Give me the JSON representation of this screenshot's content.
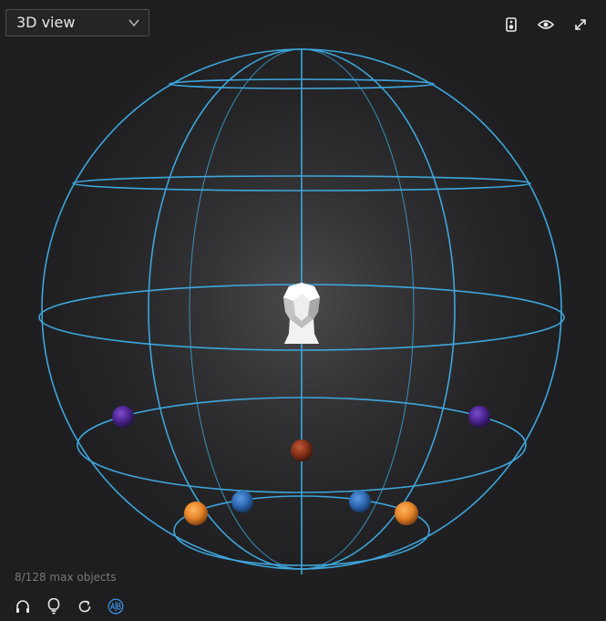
{
  "view_selector": {
    "selected": "3D view"
  },
  "toolbar_top": {
    "icons": [
      "speaker-icon",
      "eye-icon",
      "expand-icon"
    ]
  },
  "status": {
    "object_count": "8/128 max objects"
  },
  "toolbar_bottom": {
    "icons": [
      "headphones-icon",
      "lightbulb-icon",
      "reset-icon",
      "ab-compare-icon"
    ]
  },
  "colors": {
    "wireframe": "#3ea6dc",
    "accent": "#3b8fe0",
    "icon": "#e8e8e8",
    "object_orange": "#e8862a",
    "object_blue": "#2f6bb5",
    "object_purple": "#5a2aa6",
    "object_red": "#9a3a20"
  },
  "scene_objects": [
    {
      "name": "object-purple-left",
      "color": "purple"
    },
    {
      "name": "object-purple-right",
      "color": "purple"
    },
    {
      "name": "object-red-rear",
      "color": "red"
    },
    {
      "name": "object-blue-left",
      "color": "blue"
    },
    {
      "name": "object-blue-right",
      "color": "blue"
    },
    {
      "name": "object-orange-left",
      "color": "orange"
    },
    {
      "name": "object-orange-right",
      "color": "orange"
    }
  ]
}
